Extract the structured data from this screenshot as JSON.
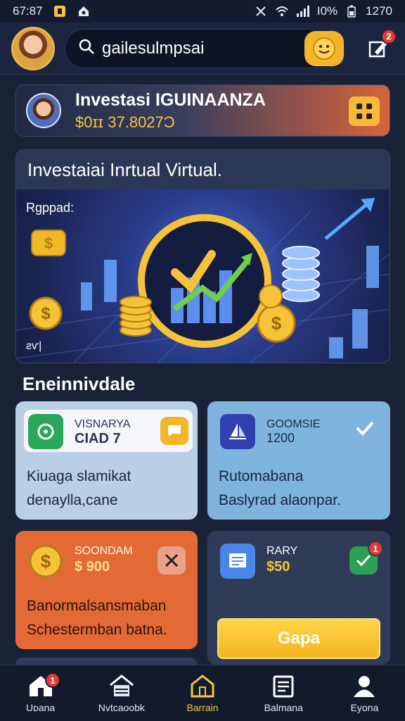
{
  "status_bar": {
    "time": "67:87",
    "battery": "Ӏ0%",
    "clock_right": "1270"
  },
  "header": {
    "search_query": "gailesulmpsai",
    "notification_count": "2"
  },
  "banner": {
    "title": "Investasi IGUINAANZA",
    "amount": "$0ɪɪ 37.8027Ͻ"
  },
  "hero": {
    "title": "Investaiai Inrtual Virtual.",
    "label_top": "Rgppad:",
    "label_bottom": "ƨѵ|"
  },
  "section": {
    "title": "Eneinnivdale"
  },
  "cards": [
    {
      "kicker": "VISNARYA",
      "kicker2": "CIAD 7",
      "body_line1": "Kiuaga slamikat",
      "body_line2": "denaylla,cane"
    },
    {
      "kicker": "GOOMSIE",
      "kicker2": "1200",
      "body_line1": "Rutomabana",
      "body_line2": "Baslyrad alaonpar."
    },
    {
      "kicker": "SOONDAM",
      "kicker2": "$ 900",
      "body_line1": "Banormalsansmaban",
      "body_line2": "Schestermban batna."
    },
    {
      "kicker": "RARY",
      "kicker2": "$50",
      "badge": "1",
      "cta_label": "Gapa"
    }
  ],
  "bottom_nav": [
    {
      "label": "Uᴅana",
      "icon": "home-icon",
      "badge": "1"
    },
    {
      "label": "Nvtcaoobk",
      "icon": "house-outline-icon"
    },
    {
      "label": "Barrain",
      "icon": "home-active-icon",
      "active": true
    },
    {
      "label": "Balmana",
      "icon": "clipboard-icon"
    },
    {
      "label": "Eyona",
      "icon": "person-icon"
    }
  ],
  "colors": {
    "background": "#1a2238",
    "accent_yellow": "#f5c542",
    "accent_orange": "#e36a37",
    "card_light_blue": "#b9d0e4",
    "card_blue": "#7fb4dd"
  }
}
